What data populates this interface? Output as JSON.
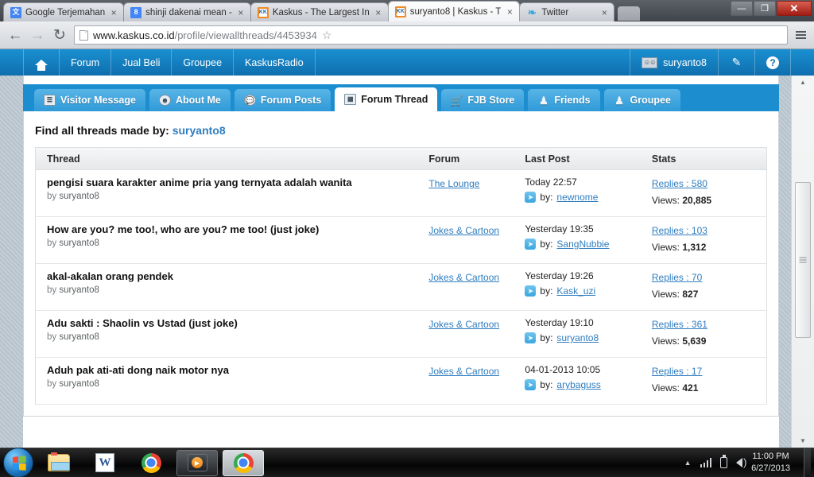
{
  "browser": {
    "tabs": [
      {
        "title": "Google Terjemahan",
        "favicon": "translate-icon",
        "favicon_text": "文",
        "active": false
      },
      {
        "title": "shinji dakenai mean -",
        "favicon": "google-icon",
        "favicon_text": "8",
        "active": false
      },
      {
        "title": "Kaskus - The Largest In",
        "favicon": "kaskus-icon",
        "favicon_text": "KK",
        "active": false
      },
      {
        "title": "suryanto8 | Kaskus - T",
        "favicon": "kaskus-icon",
        "favicon_text": "KK",
        "active": true
      },
      {
        "title": "Twitter",
        "favicon": "twitter-icon",
        "favicon_text": "❧",
        "active": false
      }
    ],
    "tab_close_label": "×",
    "window_controls": {
      "minimize": "—",
      "restore": "❐",
      "close": "✕"
    },
    "nav": {
      "back": "←",
      "forward": "→",
      "reload": "↻",
      "url_domain": "www.kaskus.co.id",
      "url_path": "/profile/viewallthreads/4453934",
      "bookmark_star": "☆"
    }
  },
  "site_nav": {
    "home_label": "home-icon",
    "items": [
      "Forum",
      "Jual Beli",
      "Groupee",
      "KaskusRadio"
    ],
    "username": "suryanto8",
    "edit_icon": "✎",
    "help_icon": "?"
  },
  "profile_tabs": [
    {
      "label": "Visitor Message",
      "icon": "note-icon",
      "glyph": "☰",
      "active": false
    },
    {
      "label": "About Me",
      "icon": "user-circle-icon",
      "glyph": "☺",
      "active": false
    },
    {
      "label": "Forum Posts",
      "icon": "speech-bubble-icon",
      "glyph": "●",
      "active": false
    },
    {
      "label": "Forum Thread",
      "icon": "calendar-icon",
      "glyph": "▦",
      "active": true
    },
    {
      "label": "FJB Store",
      "icon": "cart-icon",
      "glyph": "▤",
      "active": false
    },
    {
      "label": "Friends",
      "icon": "person-icon",
      "glyph": "●",
      "active": false
    },
    {
      "label": "Groupee",
      "icon": "group-icon",
      "glyph": "●",
      "active": false
    }
  ],
  "content": {
    "find_prefix": "Find all threads made by:",
    "find_user": "suryanto8",
    "columns": [
      "Thread",
      "Forum",
      "Last Post",
      "Stats"
    ],
    "by_prefix": "by",
    "replies_label": "Replies :",
    "views_label": "Views:",
    "arrow_glyph": "➤",
    "rows": [
      {
        "title": "pengisi suara karakter anime pria yang ternyata adalah wanita",
        "author": "suryanto8",
        "forum": "The Lounge",
        "last_post_date": "Today 22:57",
        "last_post_by_prefix": "by:",
        "last_post_by": "newnome",
        "replies": "580",
        "views": "20,885"
      },
      {
        "title": "How are you? me too!, who are you? me too! (just joke)",
        "author": "suryanto8",
        "forum": "Jokes & Cartoon",
        "last_post_date": "Yesterday 19:35",
        "last_post_by_prefix": "by:",
        "last_post_by": "SangNubbie",
        "replies": "103",
        "views": "1,312"
      },
      {
        "title": "akal-akalan orang pendek",
        "author": "suryanto8",
        "forum": "Jokes & Cartoon",
        "last_post_date": "Yesterday 19:26",
        "last_post_by_prefix": "by:",
        "last_post_by": "Kask_uzi",
        "replies": "70",
        "views": "827"
      },
      {
        "title": "Adu sakti : Shaolin vs Ustad (just joke)",
        "author": "suryanto8",
        "forum": "Jokes & Cartoon",
        "last_post_date": "Yesterday 19:10",
        "last_post_by_prefix": "by:",
        "last_post_by": "suryanto8",
        "replies": "361",
        "views": "5,639"
      },
      {
        "title": "Aduh pak ati-ati dong naik motor nya",
        "author": "suryanto8",
        "forum": "Jokes & Cartoon",
        "last_post_date": "04-01-2013 10:05",
        "last_post_by_prefix": "by:",
        "last_post_by": "arybaguss",
        "replies": "17",
        "views": "421"
      }
    ]
  },
  "scrollbar": {
    "up_arrow": "▲",
    "down_arrow": "▼"
  },
  "taskbar": {
    "start_label": "start-orb",
    "buttons": [
      {
        "name": "explorer",
        "icon": "folder-icon"
      },
      {
        "name": "word",
        "icon": "word-icon",
        "glyph": "W"
      },
      {
        "name": "chrome",
        "icon": "chrome-icon"
      },
      {
        "name": "media-player",
        "icon": "media-player-icon",
        "glyph": "▶"
      },
      {
        "name": "chrome-active",
        "icon": "chrome-icon"
      }
    ],
    "tray": {
      "overflow_arrow": "▲",
      "network_icon": "signal-bars-icon",
      "battery_icon": "battery-icon",
      "volume_icon": "speaker-icon",
      "time": "11:00 PM",
      "date": "6/27/2013"
    }
  },
  "colors": {
    "brand_blue": "#1c8ed0",
    "link_blue": "#2f7dbf",
    "nav_blue_dark": "#0f6fae"
  }
}
